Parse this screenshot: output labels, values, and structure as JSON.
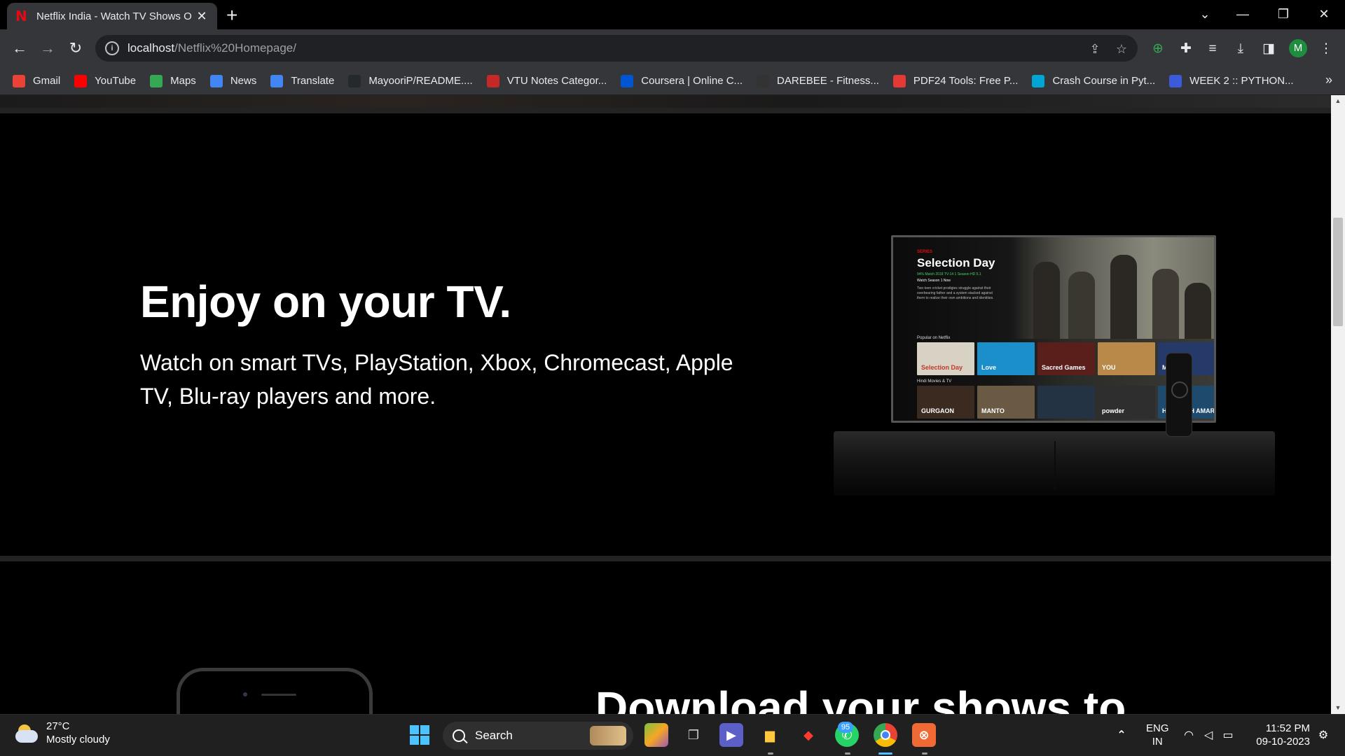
{
  "browser": {
    "tab_title": "Netflix India - Watch TV Shows O",
    "favicon": "N",
    "url_host": "localhost",
    "url_path": "/Netflix%20Homepage/",
    "profile_initial": "M",
    "bookmarks": [
      {
        "label": "Gmail",
        "icon": "gmail-icon",
        "color": "#ea4335"
      },
      {
        "label": "YouTube",
        "icon": "youtube-icon",
        "color": "#ff0000"
      },
      {
        "label": "Maps",
        "icon": "maps-icon",
        "color": "#34a853"
      },
      {
        "label": "News",
        "icon": "news-icon",
        "color": "#4285f4"
      },
      {
        "label": "Translate",
        "icon": "translate-icon",
        "color": "#4285f4"
      },
      {
        "label": "MayooriP/README....",
        "icon": "github-icon",
        "color": "#24292e"
      },
      {
        "label": "VTU Notes Categor...",
        "icon": "vtu-icon",
        "color": "#c62828"
      },
      {
        "label": "Coursera | Online C...",
        "icon": "coursera-icon",
        "color": "#0056d2"
      },
      {
        "label": "DAREBEE - Fitness...",
        "icon": "darebee-icon",
        "color": "#333333"
      },
      {
        "label": "PDF24 Tools: Free P...",
        "icon": "pdf24-icon",
        "color": "#e53935"
      },
      {
        "label": "Crash Course in Pyt...",
        "icon": "crashcourse-icon",
        "color": "#00a6d6"
      },
      {
        "label": "WEEK 2 :: PYTHON...",
        "icon": "week2-icon",
        "color": "#3b5bdb"
      }
    ],
    "more_bookmarks": "»"
  },
  "page": {
    "tv_heading": "Enjoy on your TV.",
    "tv_subtext": "Watch on smart TVs, PlayStation, Xbox, Chromecast, Apple TV, Blu-ray players and more.",
    "download_heading": "Download your shows to",
    "tv_screen": {
      "series_label": "SERIES",
      "show_title": "Selection Day",
      "meta": "94% Match 2018 TV-14 1 Season HD 5.1",
      "watch_label": "Watch Season 1 Now",
      "description": "Two teen cricket prodigies struggle against their overbearing father and a system stacked against them to realize their own ambitions and identities.",
      "row1_label": "Popular on Netflix",
      "row2_label": "Hindi Movies & TV",
      "row1_tiles": [
        "Selection Day",
        "Love",
        "Sacred Games",
        "YOU",
        "MOWGLI"
      ],
      "row2_tiles": [
        "GURGAON",
        "MANTO",
        "",
        "powder",
        "HASMUKH AMAR"
      ]
    }
  },
  "taskbar": {
    "temperature": "27°C",
    "weather": "Mostly cloudy",
    "search_label": "Search",
    "whatsapp_badge": "95",
    "lang_line1": "ENG",
    "lang_line2": "IN",
    "time": "11:52 PM",
    "date": "09-10-2023"
  }
}
